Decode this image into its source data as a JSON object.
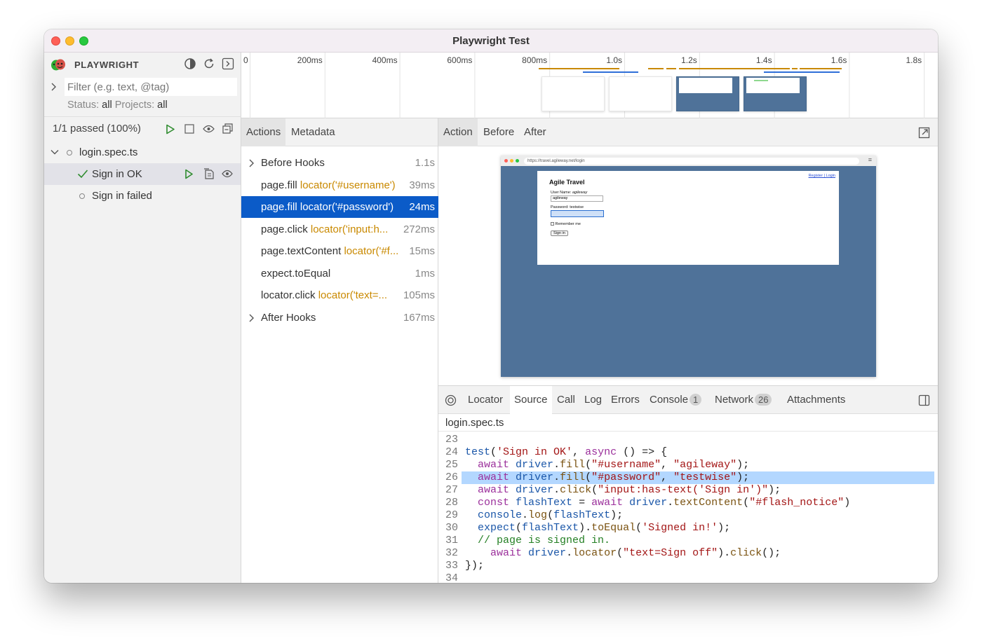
{
  "window": {
    "title": "Playwright Test"
  },
  "sidebar": {
    "brand": "PLAYWRIGHT",
    "filter_placeholder": "Filter (e.g. text, @tag)",
    "status_label": "Status:",
    "status_value": "all",
    "projects_label": "Projects:",
    "projects_value": "all",
    "summary": "1/1 passed (100%)",
    "file": "login.spec.ts",
    "tests": [
      {
        "label": "Sign in OK",
        "status": "passed"
      },
      {
        "label": "Sign in failed",
        "status": "not-run"
      }
    ]
  },
  "timeline": {
    "ticks": [
      "0",
      "200ms",
      "400ms",
      "600ms",
      "800ms",
      "1.0s",
      "1.2s",
      "1.4s",
      "1.6s",
      "1.8s"
    ]
  },
  "actions_panel": {
    "tabs": [
      "Actions",
      "Metadata"
    ],
    "items": [
      {
        "method": "Before Hooks",
        "locator": "",
        "duration": "1.1s",
        "expandable": true
      },
      {
        "method": "page.fill",
        "locator": "locator('#username')",
        "duration": "39ms"
      },
      {
        "method": "page.fill",
        "locator": "locator('#password')",
        "duration": "24ms",
        "selected": true
      },
      {
        "method": "page.click",
        "locator": "locator('input:h...",
        "duration": "272ms"
      },
      {
        "method": "page.textContent",
        "locator": "locator('#f...",
        "duration": "15ms"
      },
      {
        "method": "expect.toEqual",
        "locator": "",
        "duration": "1ms"
      },
      {
        "method": "locator.click",
        "locator": "locator('text=...",
        "duration": "105ms"
      },
      {
        "method": "After Hooks",
        "locator": "",
        "duration": "167ms",
        "expandable": true
      }
    ]
  },
  "snapshot": {
    "tabs": [
      "Action",
      "Before",
      "After"
    ],
    "url": "https://travel.agileway.net/login",
    "page": {
      "links": "Register | Login",
      "title": "Agile Travel",
      "username_label": "User Name:",
      "username_hint": "agileway",
      "username_value": "agileway",
      "password_label": "Password: testwise",
      "remember": "Remember me",
      "sign_in": "Sign in"
    }
  },
  "bottom": {
    "tabs": {
      "locator": "Locator",
      "source": "Source",
      "call": "Call",
      "log": "Log",
      "errors": "Errors",
      "console": "Console",
      "console_count": "1",
      "network": "Network",
      "network_count": "26",
      "attachments": "Attachments"
    },
    "filename": "login.spec.ts",
    "code": [
      {
        "n": "23",
        "tokens": []
      },
      {
        "n": "24",
        "tokens": [
          [
            "vr",
            "test"
          ],
          [
            "pl",
            "("
          ],
          [
            "st",
            "'Sign in OK'"
          ],
          [
            "pl",
            ", "
          ],
          [
            "kw",
            "async"
          ],
          [
            "pl",
            " () => {"
          ]
        ]
      },
      {
        "n": "25",
        "tokens": [
          [
            "pl",
            "  "
          ],
          [
            "kw",
            "await"
          ],
          [
            "pl",
            " "
          ],
          [
            "vr",
            "driver"
          ],
          [
            "pl",
            "."
          ],
          [
            "fn",
            "fill"
          ],
          [
            "pl",
            "("
          ],
          [
            "st",
            "\"#username\""
          ],
          [
            "pl",
            ", "
          ],
          [
            "st",
            "\"agileway\""
          ],
          [
            "pl",
            ");"
          ]
        ]
      },
      {
        "n": "26",
        "tokens": [
          [
            "pl",
            "  "
          ],
          [
            "kw",
            "await"
          ],
          [
            "pl",
            " "
          ],
          [
            "vr",
            "driver"
          ],
          [
            "pl",
            "."
          ],
          [
            "fn",
            "fill"
          ],
          [
            "pl",
            "("
          ],
          [
            "st",
            "\"#password\""
          ],
          [
            "pl",
            ", "
          ],
          [
            "st",
            "\"testwise\""
          ],
          [
            "pl",
            ");"
          ]
        ],
        "highlight": true
      },
      {
        "n": "27",
        "tokens": [
          [
            "pl",
            "  "
          ],
          [
            "kw",
            "await"
          ],
          [
            "pl",
            " "
          ],
          [
            "vr",
            "driver"
          ],
          [
            "pl",
            "."
          ],
          [
            "fn",
            "click"
          ],
          [
            "pl",
            "("
          ],
          [
            "st",
            "\"input:has-text('Sign in')\""
          ],
          [
            "pl",
            ");"
          ]
        ]
      },
      {
        "n": "28",
        "tokens": [
          [
            "pl",
            "  "
          ],
          [
            "kw",
            "const"
          ],
          [
            "pl",
            " "
          ],
          [
            "vr",
            "flashText"
          ],
          [
            "pl",
            " = "
          ],
          [
            "kw",
            "await"
          ],
          [
            "pl",
            " "
          ],
          [
            "vr",
            "driver"
          ],
          [
            "pl",
            "."
          ],
          [
            "fn",
            "textContent"
          ],
          [
            "pl",
            "("
          ],
          [
            "st",
            "\"#flash_notice\""
          ],
          [
            "pl",
            ")"
          ]
        ]
      },
      {
        "n": "29",
        "tokens": [
          [
            "pl",
            "  "
          ],
          [
            "vr",
            "console"
          ],
          [
            "pl",
            "."
          ],
          [
            "fn",
            "log"
          ],
          [
            "pl",
            "("
          ],
          [
            "vr",
            "flashText"
          ],
          [
            "pl",
            ");"
          ]
        ]
      },
      {
        "n": "30",
        "tokens": [
          [
            "pl",
            "  "
          ],
          [
            "vr",
            "expect"
          ],
          [
            "pl",
            "("
          ],
          [
            "vr",
            "flashText"
          ],
          [
            "pl",
            ")."
          ],
          [
            "fn",
            "toEqual"
          ],
          [
            "pl",
            "("
          ],
          [
            "st",
            "'Signed in!'"
          ],
          [
            "pl",
            ");"
          ]
        ]
      },
      {
        "n": "31",
        "tokens": [
          [
            "pl",
            "  "
          ],
          [
            "cm",
            "// page is signed in."
          ]
        ]
      },
      {
        "n": "32",
        "tokens": [
          [
            "pl",
            "    "
          ],
          [
            "kw",
            "await"
          ],
          [
            "pl",
            " "
          ],
          [
            "vr",
            "driver"
          ],
          [
            "pl",
            "."
          ],
          [
            "fn",
            "locator"
          ],
          [
            "pl",
            "("
          ],
          [
            "st",
            "\"text=Sign off\""
          ],
          [
            "pl",
            ")."
          ],
          [
            "fn",
            "click"
          ],
          [
            "pl",
            "();"
          ]
        ]
      },
      {
        "n": "33",
        "tokens": [
          [
            "pl",
            "});"
          ]
        ]
      },
      {
        "n": "34",
        "tokens": []
      }
    ]
  }
}
